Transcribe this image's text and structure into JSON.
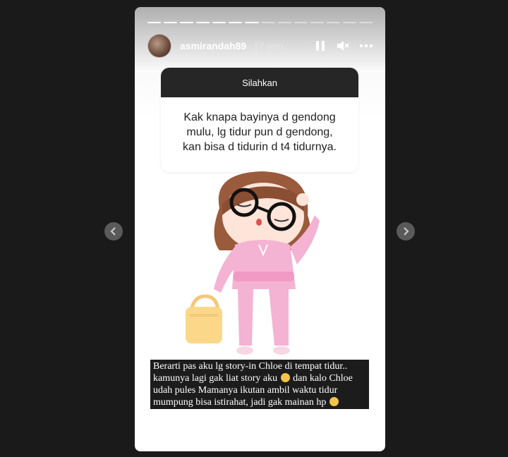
{
  "story": {
    "progress_segments": 14,
    "progress_completed": 7,
    "user": {
      "username": "asmirandah89",
      "time": "17 jam"
    },
    "controls": [
      "pause-icon",
      "mute-icon",
      "more-icon"
    ],
    "question_box": {
      "header": "Silahkan",
      "question_lines": [
        "Kak knapa bayinya d gendong",
        "mulu, lg tidur pun d gendong,",
        "kan bisa d tidurin d t4 tidurnya."
      ]
    },
    "caption_lines": [
      "Berarti pas aku lg story-in Chloe di tempat tidur..",
      "kamunya lagi gak liat story aku",
      "dan kalo Chloe",
      "udah pules Mamanya ikutan ambil waktu tidur",
      "mumpung bisa istirahat, jadi gak mainan hp"
    ]
  },
  "navigation": {
    "prev": "chevron-left-icon",
    "next": "chevron-right-icon"
  },
  "colors": {
    "background": "#1a1a1a",
    "question_header": "#262626",
    "caption_bg": "#1c1c1c",
    "sticker_pink": "#f4b3d3"
  }
}
